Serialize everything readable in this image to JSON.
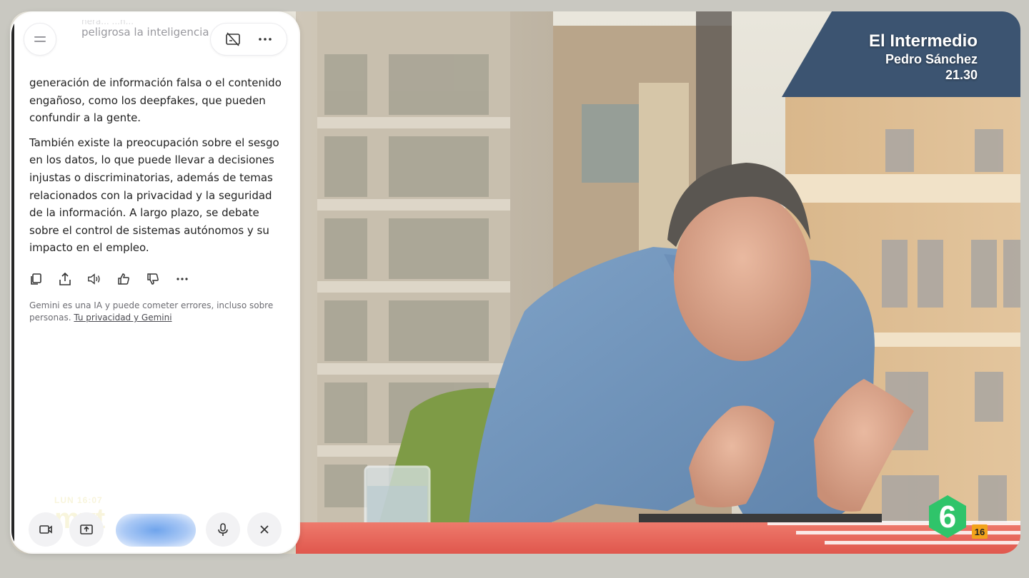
{
  "broadcast": {
    "show_name": "El Intermedio",
    "guest_name": "Pedro Sánchez",
    "air_time": "21.30",
    "age_rating": "16",
    "channel_logo": "laSexta-6-logo"
  },
  "gemini": {
    "top_partial_text": "peligrosa la inteligencia artificial",
    "top_faint_text": "nera... ...n...",
    "paragraphs": [
      "generación de información falsa o el contenido engañoso, como los deepfakes, que pueden confundir a la gente.",
      "También existe la preocupación sobre el sesgo en los datos, lo que puede llevar a decisiones injustas o discriminatorias, además de temas relacionados con la privacidad y la seguridad de la información. A largo plazo, se debate sobre el control de sistemas autónomos y su impacto en el empleo."
    ],
    "disclaimer_text": "Gemini es una IA y puede cometer errores, incluso sobre personas. ",
    "disclaimer_link": "Tu privacidad y Gemini",
    "icons": {
      "menu": "menu-icon",
      "no_subtitles": "captions-off-icon",
      "more": "more-horizontal-icon",
      "copy": "copy-icon",
      "share": "share-icon",
      "read_aloud": "speaker-icon",
      "like": "thumbs-up-icon",
      "dislike": "thumbs-down-icon",
      "more_actions": "more-horizontal-icon",
      "camera": "video-camera-icon",
      "screen_share": "screen-share-icon",
      "microphone": "microphone-icon",
      "close": "close-icon"
    },
    "watermark_small": "LUN 16:07",
    "watermark_big": "mvt"
  },
  "colors": {
    "accent_green": "#2fc46a",
    "badge_orange": "#f2a21a",
    "desk_red": "#e86a5f"
  }
}
